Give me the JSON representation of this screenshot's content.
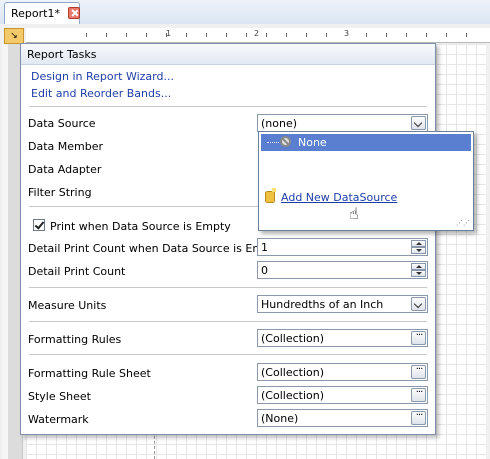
{
  "tab": {
    "title": "Report1*"
  },
  "ruler": {
    "labels": [
      "1",
      "2",
      "3"
    ]
  },
  "panel": {
    "title": "Report Tasks",
    "links": [
      "Design in Report Wizard...",
      "Edit and Reorder Bands..."
    ],
    "data_source": {
      "label": "Data Source",
      "value": "(none)"
    },
    "data_member": {
      "label": "Data Member"
    },
    "data_adapter": {
      "label": "Data Adapter"
    },
    "filter_string": {
      "label": "Filter String"
    },
    "print_when_empty": {
      "label": "Print when Data Source is Empty",
      "checked": true
    },
    "detail_count_empty": {
      "label": "Detail Print Count when Data Source is Empty",
      "value": "1"
    },
    "detail_count": {
      "label": "Detail Print Count",
      "value": "0"
    },
    "measure_units": {
      "label": "Measure Units",
      "value": "Hundredths of an Inch"
    },
    "formatting_rules": {
      "label": "Formatting Rules",
      "value": "(Collection)"
    },
    "formatting_rule_sheet": {
      "label": "Formatting Rule Sheet",
      "value": "(Collection)"
    },
    "style_sheet": {
      "label": "Style Sheet",
      "value": "(Collection)"
    },
    "watermark": {
      "label": "Watermark",
      "value": "(None)"
    }
  },
  "datasource_popup": {
    "selected": "None",
    "add_label": "Add New DataSource"
  }
}
